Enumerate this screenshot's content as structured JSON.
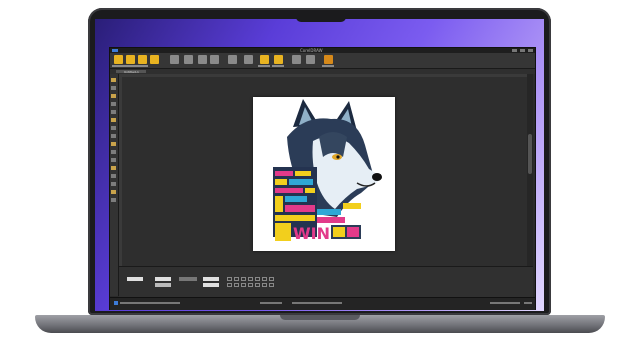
{
  "app": {
    "title": "CorelDRAW",
    "tab_label": "Untitled-1",
    "icon": "app-logo-icon"
  },
  "toolbar": {
    "tools": [
      "new-icon",
      "open-icon",
      "save-icon",
      "print-icon",
      "import-icon",
      "export-icon",
      "undo-icon",
      "redo-icon",
      "zoom-icon",
      "snap-icon",
      "options-icon",
      "launch-icon"
    ]
  },
  "artboard": {
    "image": "wolf-word-art-illustration",
    "words_visible": [
      "WIN",
      "CONQUER",
      "POWER",
      "STRONG",
      "GLORY",
      "FOCUS"
    ]
  },
  "colors": {
    "wallpaper_start": "#2a1e78",
    "wallpaper_end": "#e2d8ff",
    "app_bg": "#2b2b2b",
    "accent_yellow": "#e8b321"
  }
}
